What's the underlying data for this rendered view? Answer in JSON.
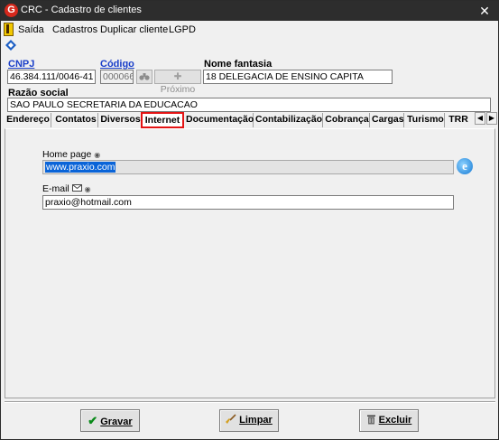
{
  "window": {
    "title": "CRC - Cadastro de clientes",
    "close_glyph": "✕"
  },
  "menu": {
    "items": [
      "Saída",
      "Cadastros",
      "Duplicar cliente",
      "LGPD"
    ]
  },
  "header": {
    "cnpj_label": "CNPJ",
    "cnpj_value": "46.384.111/0046-41",
    "codigo_label": "Código",
    "codigo_value": "000066",
    "proximo_label": "Próximo",
    "nome_fantasia_label": "Nome fantasia",
    "nome_fantasia_value": "18 DELEGACIA DE ENSINO  CAPITA",
    "razao_social_label": "Razão social",
    "razao_social_value": "SAO PAULO SECRETARIA DA EDUCACAO"
  },
  "tabs": [
    {
      "label": "Endereço"
    },
    {
      "label": "Contatos"
    },
    {
      "label": "Diversos"
    },
    {
      "label": "Internet"
    },
    {
      "label": "Documentação"
    },
    {
      "label": "Contabilização"
    },
    {
      "label": "Cobrança"
    },
    {
      "label": "Cargas"
    },
    {
      "label": "Turismo"
    },
    {
      "label": "TRR"
    }
  ],
  "active_tab": "Internet",
  "internet": {
    "homepage_label": "Home page",
    "homepage_value": "www.praxio.com",
    "email_label": "E-mail",
    "email_value": "praxio@hotmail.com"
  },
  "actions": {
    "gravar": "Gravar",
    "limpar": "Limpar",
    "excluir": "Excluir"
  },
  "colors": {
    "active_tab_border": "#e41414",
    "link": "#1a3fc9",
    "selection": "#0a64d8"
  },
  "icons": [
    "app-logo-icon",
    "exit-door-icon",
    "navigation-icon",
    "binoculars-icon",
    "plus-icon",
    "browser-icon",
    "email-icon",
    "check-icon",
    "broom-icon",
    "trash-icon"
  ]
}
